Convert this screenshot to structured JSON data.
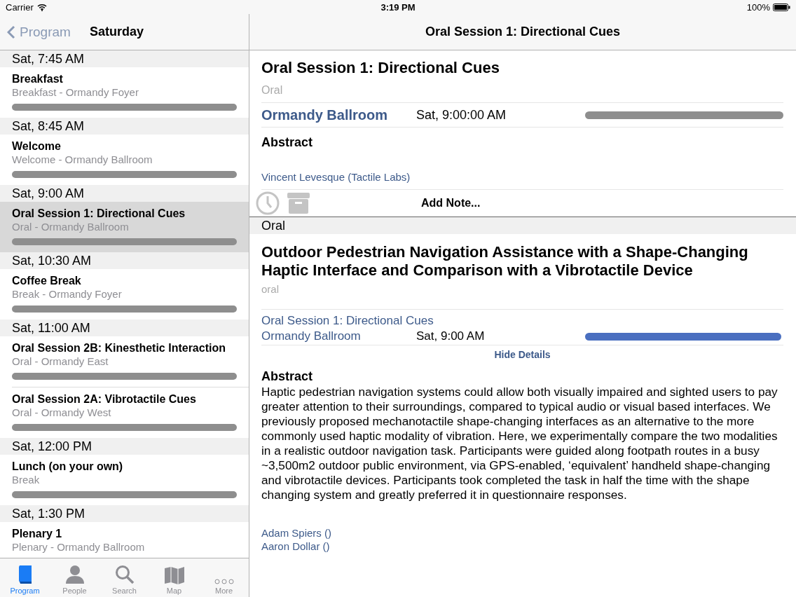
{
  "status_bar": {
    "carrier": "Carrier",
    "time": "3:19 PM",
    "battery": "100%"
  },
  "sidebar": {
    "back": "Program",
    "title": "Saturday",
    "sections": [
      {
        "header": "Sat, 7:45 AM",
        "items": [
          {
            "title": "Breakfast",
            "subtitle": "Breakfast - Ormandy Foyer",
            "color": "#8e8e8e",
            "selected": false
          }
        ]
      },
      {
        "header": "Sat, 8:45 AM",
        "items": [
          {
            "title": "Welcome",
            "subtitle": "Welcome - Ormandy Ballroom",
            "color": "#8e8e8e",
            "selected": false
          }
        ]
      },
      {
        "header": "Sat, 9:00 AM",
        "items": [
          {
            "title": "Oral Session 1: Directional Cues",
            "subtitle": "Oral - Ormandy Ballroom",
            "color": "#8e8e8e",
            "selected": true
          }
        ]
      },
      {
        "header": "Sat, 10:30 AM",
        "items": [
          {
            "title": "Coffee Break",
            "subtitle": "Break - Ormandy Foyer",
            "color": "#8e8e8e",
            "selected": false
          }
        ]
      },
      {
        "header": "Sat, 11:00 AM",
        "items": [
          {
            "title": "Oral Session 2B: Kinesthetic Interaction",
            "subtitle": "Oral - Ormandy East",
            "color": "#8e8e8e",
            "selected": false
          },
          {
            "title": "Oral Session 2A: Vibrotactile Cues",
            "subtitle": "Oral - Ormandy West",
            "color": "#8e8e8e",
            "selected": false
          }
        ]
      },
      {
        "header": "Sat, 12:00 PM",
        "items": [
          {
            "title": "Lunch (on your own)",
            "subtitle": "Break",
            "color": "#8e8e8e",
            "selected": false
          }
        ]
      },
      {
        "header": "Sat, 1:30 PM",
        "items": [
          {
            "title": "Plenary 1",
            "subtitle": "Plenary - Ormandy Ballroom",
            "selected": false
          }
        ]
      }
    ]
  },
  "tab_bar": [
    {
      "label": "Program",
      "selected": true
    },
    {
      "label": "People",
      "selected": false
    },
    {
      "label": "Search",
      "selected": false
    },
    {
      "label": "Map",
      "selected": false
    },
    {
      "label": "More",
      "selected": false
    }
  ],
  "detail": {
    "nav_title": "Oral Session 1: Directional Cues",
    "session": {
      "title": "Oral Session 1: Directional Cues",
      "type": "Oral",
      "room": "Ormandy Ballroom",
      "time": "Sat, 9:00:00 AM",
      "color": "#8e8e8e",
      "abstract_heading": "Abstract",
      "author": "Vincent Levesque (Tactile Labs)",
      "add_note": "Add Note..."
    },
    "paper": {
      "section_header": "Oral",
      "title": "Outdoor Pedestrian Navigation Assistance with a Shape-Changing Haptic Interface and Comparison with a Vibrotactile Device",
      "type": "oral",
      "session": "Oral Session 1: Directional Cues",
      "room": "Ormandy Ballroom",
      "time": "Sat, 9:00 AM",
      "color": "#4a6fc0",
      "hide_details": "Hide Details",
      "abstract_heading": "Abstract",
      "abstract": "Haptic pedestrian navigation systems could allow both visually impaired and sighted users to pay greater attention to their surroundings, compared to typical audio or visual based interfaces. We previously proposed mechanotactile shape-changing interfaces as an alternative to the more commonly used haptic modality of vibration. Here, we experimentally compare the two modalities in a realistic outdoor navigation task. Participants were guided along footpath routes in a busy ~3,500m2 outdoor public environment, via GPS-enabled, ‘equivalent’ handheld shape-changing and vibrotactile devices. Participants took completed the task in half the time with the shape changing system and greatly preferred it in questionnaire responses.",
      "authors": [
        "Adam Spiers ()",
        "Aaron Dollar ()"
      ]
    }
  }
}
